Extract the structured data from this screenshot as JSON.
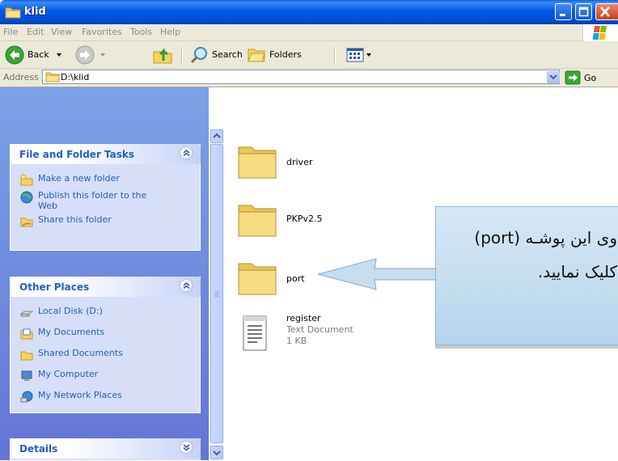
{
  "window": {
    "title": "klid"
  },
  "menu": [
    "File",
    "Edit",
    "View",
    "Favorites",
    "Tools",
    "Help"
  ],
  "toolbar": {
    "back_label": "Back",
    "search_label": "Search",
    "folders_label": "Folders"
  },
  "address": {
    "label": "Address",
    "value": "D:\\klid",
    "go_label": "Go"
  },
  "tasks_panel": {
    "title": "File and Folder Tasks",
    "items": [
      {
        "label": "Make a new folder",
        "icon": "new-folder-icon"
      },
      {
        "label": "Publish this folder to the Web",
        "icon": "publish-web-icon"
      },
      {
        "label": "Share this folder",
        "icon": "share-folder-icon"
      }
    ]
  },
  "other_places": {
    "title": "Other Places",
    "items": [
      {
        "label": "Local Disk (D:)",
        "icon": "local-disk-icon"
      },
      {
        "label": "My Documents",
        "icon": "my-documents-icon"
      },
      {
        "label": "Shared Documents",
        "icon": "shared-documents-icon"
      },
      {
        "label": "My Computer",
        "icon": "my-computer-icon"
      },
      {
        "label": "My Network Places",
        "icon": "network-places-icon"
      }
    ]
  },
  "details_panel": {
    "title": "Details"
  },
  "files": [
    {
      "name": "driver",
      "type": "folder"
    },
    {
      "name": "PKPv2.5",
      "type": "folder"
    },
    {
      "name": "port",
      "type": "folder"
    },
    {
      "name": "register",
      "type": "text",
      "subtype": "Text Document",
      "size": "1 KB"
    }
  ],
  "callout": {
    "line1": "وی این پوشـه (port)",
    "line2": "کلیک نمایید."
  },
  "colors": {
    "titlebar": "#0058e6",
    "taskpane": "#6375d6",
    "link": "#215dc6",
    "callout": "#c6def0"
  }
}
